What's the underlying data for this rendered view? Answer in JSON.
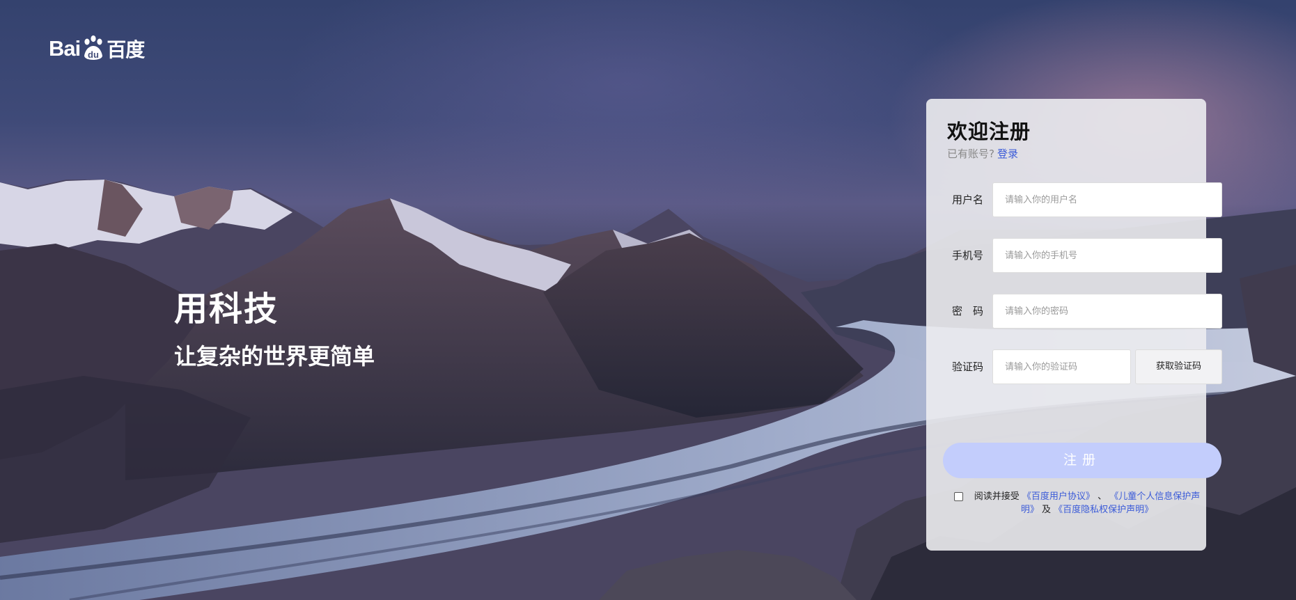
{
  "logo": {
    "text": "Bai",
    "paw_text": "du",
    "cn_text": "百度"
  },
  "slogan": {
    "title": "用科技",
    "subtitle": "让复杂的世界更简单"
  },
  "register": {
    "title": "欢迎注册",
    "have_account": "已有账号?",
    "login_link": "登录",
    "fields": {
      "username": {
        "label": "用户名",
        "placeholder": "请输入你的用户名",
        "value": ""
      },
      "phone": {
        "label": "手机号",
        "placeholder": "请输入你的手机号",
        "value": ""
      },
      "password": {
        "label": "密　码",
        "placeholder": "请输入你的密码",
        "value": ""
      },
      "code": {
        "label": "验证码",
        "placeholder": "请输入你的验证码",
        "value": ""
      }
    },
    "get_code_label": "获取验证码",
    "submit_label": "注册",
    "agreement": {
      "prefix": "阅读并接受",
      "link_user": "《百度用户协议》",
      "sep": "、",
      "link_child": "《儿童个人信息保护声明》",
      "and": "及",
      "link_privacy": "《百度隐私权保护声明》",
      "checked": false
    }
  },
  "colors": {
    "link": "#3b5bd8",
    "submit_bg": "#c3cdfc",
    "panel_bg": "#ececf0"
  }
}
